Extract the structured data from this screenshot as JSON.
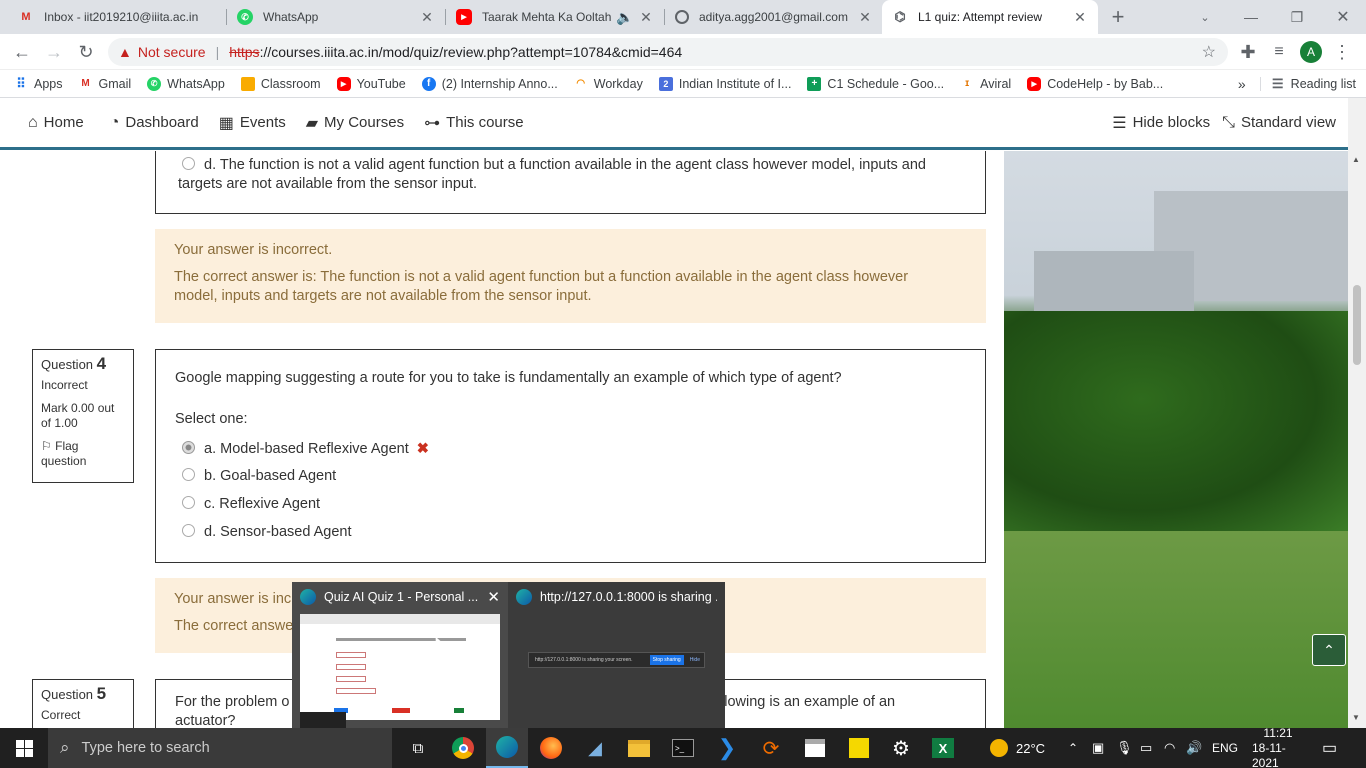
{
  "tabs": [
    {
      "label": "Inbox - iit2019210@iiita.ac.in",
      "icon": "gmail-icon",
      "active": false
    },
    {
      "label": "WhatsApp",
      "icon": "whatsapp-icon",
      "active": false
    },
    {
      "label": "Taarak Mehta Ka Ooltah",
      "icon": "youtube-icon",
      "active": false
    },
    {
      "label": "aditya.agg2001@gmail.com",
      "icon": "account-icon",
      "active": false
    },
    {
      "label": "L1 quiz: Attempt review",
      "icon": "moodle-icon",
      "active": true
    }
  ],
  "omnibox": {
    "security_label": "Not secure",
    "url_scheme": "https",
    "url_rest": "://courses.iiita.ac.in/mod/quiz/review.php?attempt=10784&cmid=464",
    "profile_initial": "A"
  },
  "bookmarks": {
    "items": [
      "Apps",
      "Gmail",
      "WhatsApp",
      "Classroom",
      "YouTube",
      "(2) Internship Anno...",
      "Workday",
      "Indian Institute of I...",
      "C1 Schedule - Goo...",
      "Aviral",
      "CodeHelp - by Bab..."
    ],
    "reading_list": "Reading list"
  },
  "moodle_nav": {
    "home": "Home",
    "dashboard": "Dashboard",
    "events": "Events",
    "my_courses": "My Courses",
    "this_course": "This course",
    "hide_blocks": "Hide blocks",
    "standard_view": "Standard view"
  },
  "q3": {
    "option_d": "d. The function is not a valid agent function but a function available in the agent class however model, inputs and",
    "option_d_cont": "targets are not available from the sensor input.",
    "feedback_status": "Your answer is incorrect.",
    "feedback_correct": "The correct answer is: The function is not a valid agent function but a function available in the agent class however",
    "feedback_correct_cont": "model, inputs and targets are not available from the sensor input."
  },
  "q4": {
    "label": "Question",
    "number": "4",
    "state": "Incorrect",
    "mark_line1": "Mark 0.00 out",
    "mark_line2": "of 1.00",
    "flag_line1": "Flag",
    "flag_line2": "question",
    "text": "Google mapping suggesting a route for you to take is fundamentally an example of which type of agent?",
    "prompt": "Select one:",
    "options": [
      "a. Model-based Reflexive Agent",
      "b. Goal-based Agent",
      "c. Reflexive Agent",
      "d. Sensor-based Agent"
    ],
    "feedback_status": "Your answer is inc",
    "feedback_correct": "The correct answe"
  },
  "q5": {
    "label": "Question",
    "number": "5",
    "state": "Correct",
    "text_start": "For the problem o",
    "text_end": "llowing is an example of an",
    "text_cont": "actuator?"
  },
  "popup": {
    "window1_title": "Quiz AI Quiz 1 - Personal ...",
    "window2_title": "http://127.0.0.1:8000 is sharing ...",
    "window2_preview_text": "http://127.0.0.1:8000 is sharing your screen.",
    "stop_sharing": "Stop sharing",
    "hide": "Hide"
  },
  "taskbar": {
    "search_placeholder": "Type here to search",
    "weather": "22°C",
    "language": "ENG",
    "time": "11:21",
    "date": "18-11-2021"
  },
  "colors": {
    "feedback_bg": "#fcefdc",
    "feedback_text": "#8a6d3b",
    "incorrect_mark": "#ca3120",
    "nav_accent": "#2d6f8a"
  }
}
